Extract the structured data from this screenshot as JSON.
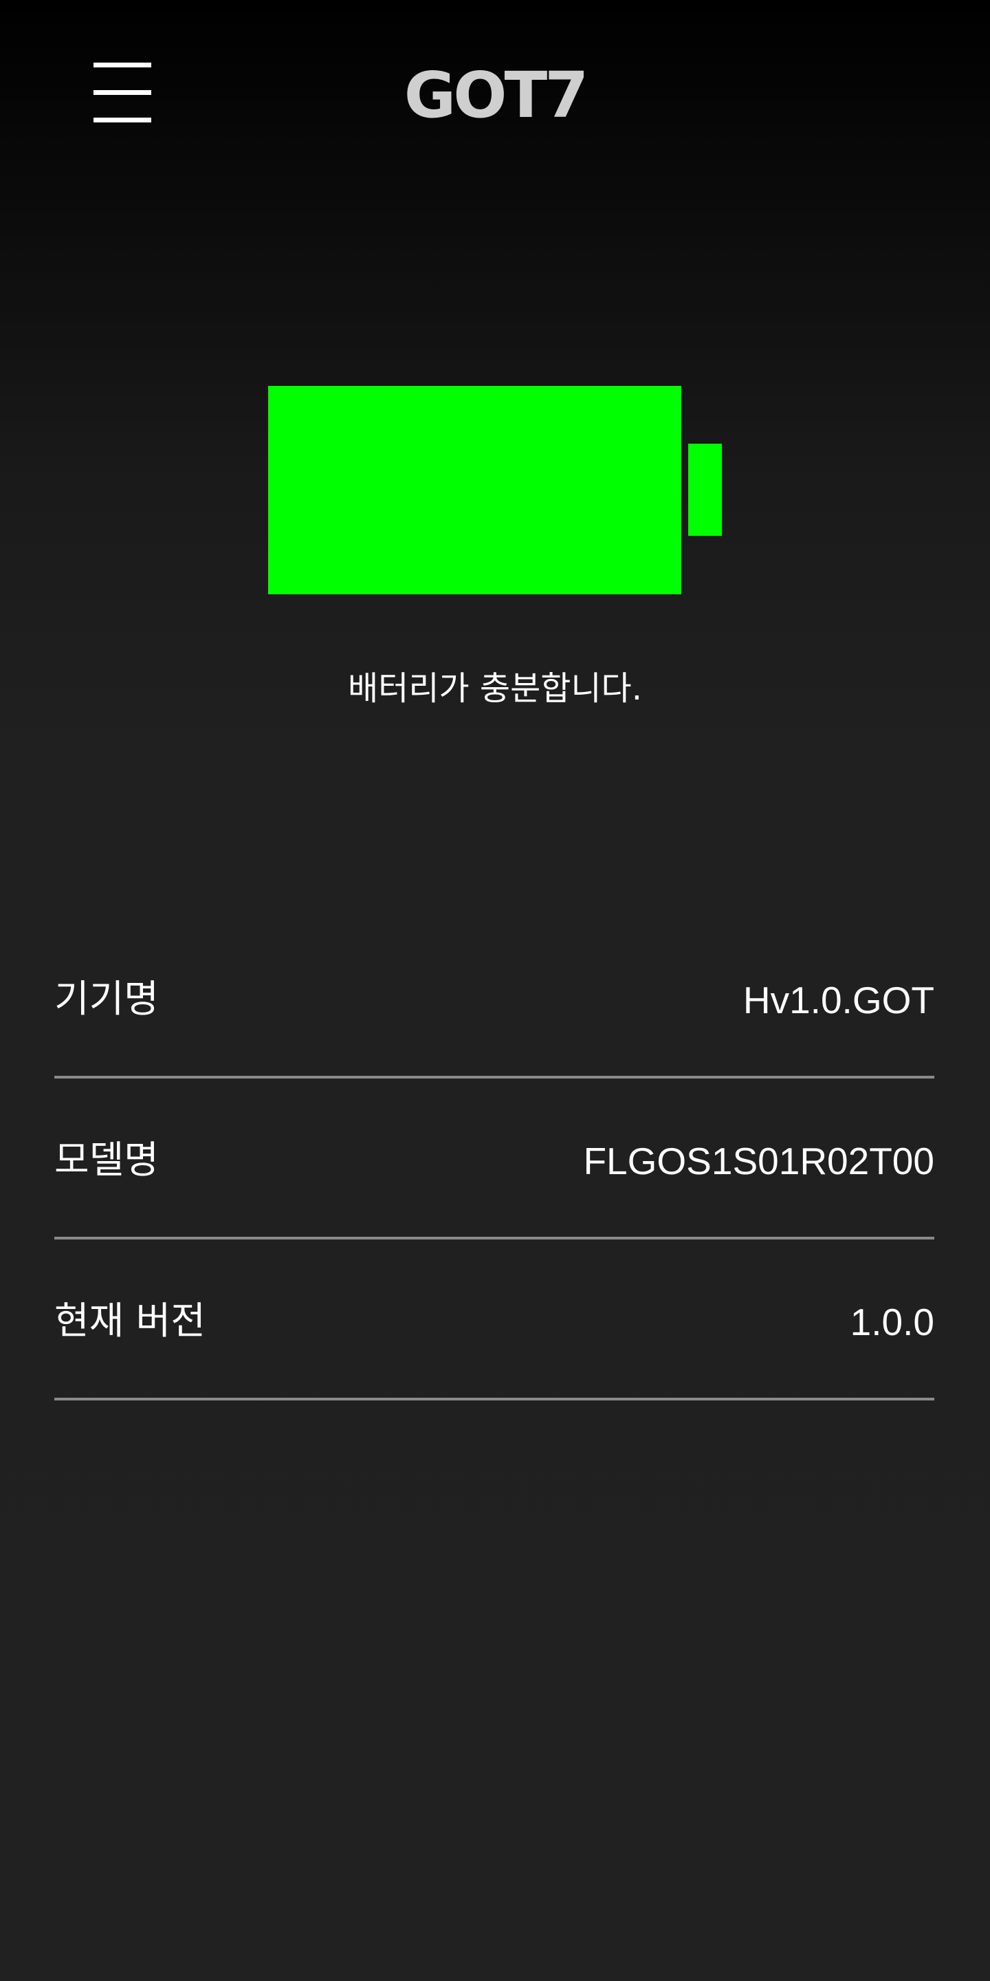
{
  "header": {
    "menu_icon": "hamburger-menu-icon",
    "logo_text": "GOT7",
    "logo_color": "#cfcfcf"
  },
  "battery": {
    "level": 1.0,
    "fill_color": "#00ff00",
    "status_text": "배터리가 충분합니다."
  },
  "device_info": {
    "rows": [
      {
        "label": "기기명",
        "value": "Hv1.0.GOT"
      },
      {
        "label": "모델명",
        "value": "FLGOS1S01R02T00"
      },
      {
        "label": "현재 버전",
        "value": "1.0.0"
      }
    ]
  }
}
